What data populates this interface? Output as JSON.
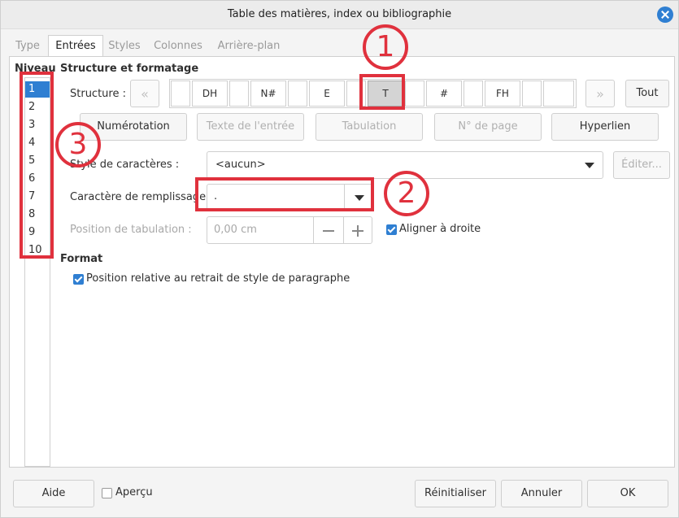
{
  "window": {
    "title": "Table des matières, index ou bibliographie"
  },
  "tabs": [
    "Type",
    "Entrées",
    "Styles",
    "Colonnes",
    "Arrière-plan"
  ],
  "level": {
    "header": "Niveau",
    "items": [
      "1",
      "2",
      "3",
      "4",
      "5",
      "6",
      "7",
      "8",
      "9",
      "10"
    ]
  },
  "structure": {
    "section_title": "Structure et formatage",
    "label": "Structure :",
    "tokens": [
      "DH",
      "N#",
      "E",
      "T",
      "#",
      "FH"
    ],
    "all_button": "Tout"
  },
  "insert_buttons": [
    "Numérotation",
    "Texte de l'entrée",
    "Tabulation",
    "N° de page",
    "Hyperlien"
  ],
  "char_style": {
    "label": "Style de caractères :",
    "value": "<aucun>",
    "edit_button": "Éditer..."
  },
  "fill_char": {
    "label": "Caractère de remplissage :",
    "value": "."
  },
  "tab_position": {
    "label": "Position de tabulation :",
    "value": "0,00 cm",
    "align_right_label": "Aligner à droite"
  },
  "format": {
    "section_title": "Format",
    "relative_label": "Position relative au retrait de style de paragraphe"
  },
  "footer": {
    "help": "Aide",
    "preview": "Aperçu",
    "reset": "Réinitialiser",
    "cancel": "Annuler",
    "ok": "OK"
  },
  "callouts": [
    "1",
    "2",
    "3"
  ],
  "colors": {
    "accent": "#2f7fd2",
    "annotation": "#e0313d"
  }
}
